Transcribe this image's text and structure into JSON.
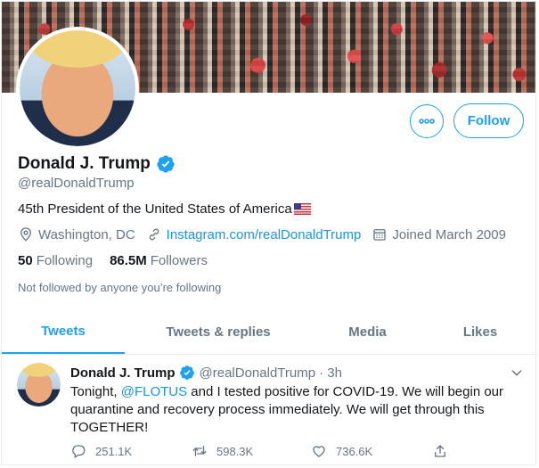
{
  "profile": {
    "display_name": "Donald J. Trump",
    "handle": "@realDonaldTrump",
    "bio": "45th President of the United States of America",
    "location": "Washington, DC",
    "website": "Instagram.com/realDonaldTrump",
    "joined": "Joined March 2009",
    "following_count": "50",
    "following_label": "Following",
    "followers_count": "86.5M",
    "followers_label": "Followers",
    "not_followed_text": "Not followed by anyone you’re following",
    "follow_label": "Follow"
  },
  "tabs": [
    {
      "label": "Tweets",
      "active": true
    },
    {
      "label": "Tweets & replies",
      "active": false
    },
    {
      "label": "Media",
      "active": false
    },
    {
      "label": "Likes",
      "active": false
    }
  ],
  "tweet": {
    "name": "Donald J. Trump",
    "handle": "@realDonaldTrump",
    "time": "· 3h",
    "text_before": "Tonight, ",
    "mention": "@FLOTUS",
    "text_after": " and I tested positive for COVID-19. We will begin our quarantine and recovery process immediately. We will get through this TOGETHER!",
    "replies": "251.1K",
    "retweets": "598.3K",
    "likes": "736.6K"
  },
  "icons": {
    "verified": "verified-badge-icon",
    "flag": "us-flag-icon",
    "location": "location-pin-icon",
    "link": "link-icon",
    "calendar": "calendar-icon",
    "more": "more-dots-icon",
    "caret": "chevron-down-icon",
    "reply": "reply-icon",
    "retweet": "retweet-icon",
    "like": "heart-icon",
    "share": "share-icon"
  },
  "colors": {
    "accent": "#1da1f2",
    "link": "#1b95e0",
    "text": "#14171a",
    "muted": "#657786",
    "border": "#e6ecf0"
  }
}
